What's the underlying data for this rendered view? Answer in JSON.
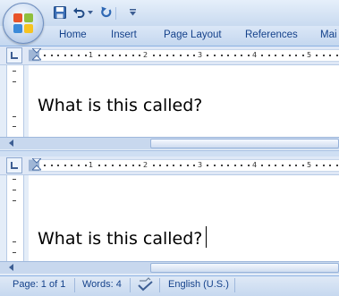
{
  "ribbon": {
    "tabs": [
      {
        "label": "Home"
      },
      {
        "label": "Insert"
      },
      {
        "label": "Page Layout"
      },
      {
        "label": "References"
      },
      {
        "label": "Mai"
      }
    ]
  },
  "quick_access": {
    "save_icon": "floppy-disk-icon",
    "undo_icon": "undo-arrow-icon",
    "redo_icon": "redo-arrow-icon",
    "customize_icon": "dropdown-arrow-icon"
  },
  "ruler": {
    "numbers": [
      "1",
      "2",
      "3",
      "4",
      "5"
    ]
  },
  "top_pane": {
    "text": "What is this called?"
  },
  "bottom_pane": {
    "text": "What is this called?"
  },
  "statusbar": {
    "page": "Page: 1 of 1",
    "words": "Words: 4",
    "language": "English (U.S.)"
  },
  "colors": {
    "ribbon_text": "#15428b",
    "frame": "#c4d7ef",
    "accent_orange": "#f07a1a"
  }
}
